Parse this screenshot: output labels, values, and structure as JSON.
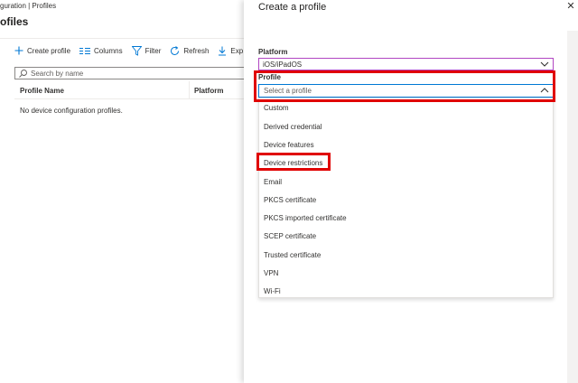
{
  "breadcrumb": "guration | Profiles",
  "page_title": "ofiles",
  "toolbar": {
    "create_profile": "Create profile",
    "columns": "Columns",
    "filter": "Filter",
    "refresh": "Refresh",
    "export": "Exp"
  },
  "search": {
    "placeholder": "Search by name"
  },
  "table": {
    "columns": [
      "Profile Name",
      "Platform"
    ],
    "empty_message": "No device configuration profiles."
  },
  "panel": {
    "title": "Create a profile",
    "close_glyph": "✕",
    "platform_label": "Platform",
    "platform_value": "iOS/iPadOS",
    "profile_label": "Profile",
    "profile_placeholder": "Select a profile",
    "options": [
      "Custom",
      "Derived credential",
      "Device features",
      "Device restrictions",
      "Email",
      "PKCS certificate",
      "PKCS imported certificate",
      "SCEP certificate",
      "Trusted certificate",
      "VPN",
      "Wi-Fi"
    ]
  },
  "colors": {
    "accent": "#0078d4",
    "highlight": "#e00000",
    "platform_border": "#b146c2"
  },
  "icons": [
    "plus-icon",
    "columns-icon",
    "filter-icon",
    "refresh-icon",
    "download-icon",
    "search-icon",
    "chevron-down-icon",
    "chevron-up-icon",
    "close-icon"
  ]
}
